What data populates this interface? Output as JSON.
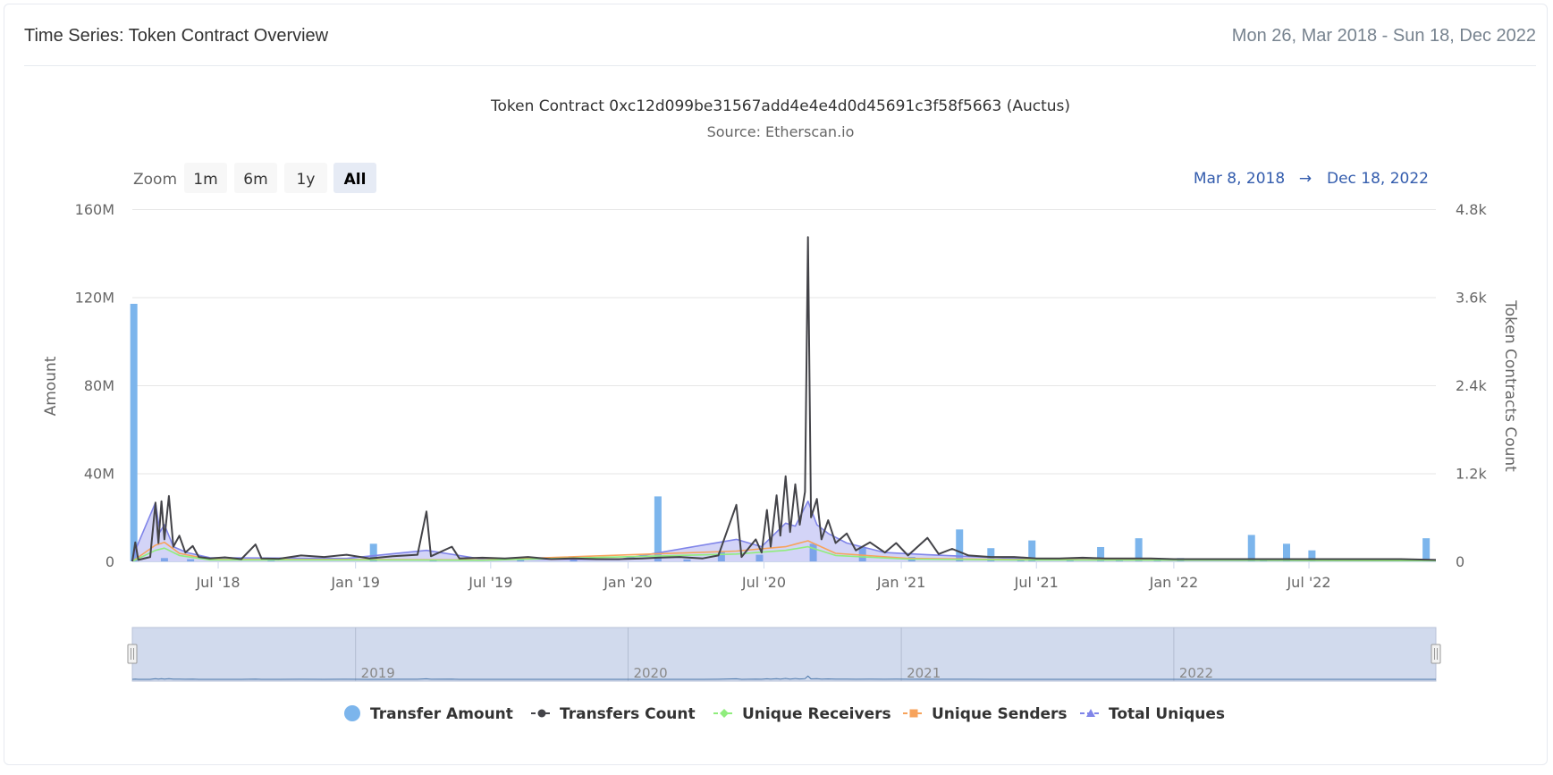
{
  "header": {
    "title": "Time Series: Token Contract Overview",
    "date_range": "Mon 26, Mar 2018 - Sun 18, Dec 2022"
  },
  "chart_data": {
    "type": "bar+line",
    "title": "Token Contract 0xc12d099be31567add4e4e4d0d45691c3f58f5663 (Auctus)",
    "subtitle": "Source: Etherscan.io",
    "zoom": {
      "label": "Zoom",
      "buttons": [
        "1m",
        "6m",
        "1y",
        "All"
      ],
      "selected": "All"
    },
    "range_selector": {
      "from": "Mar 8, 2018",
      "arrow": "→",
      "to": "Dec 18, 2022"
    },
    "x_ticks": [
      "Jul '18",
      "Jan '19",
      "Jul '19",
      "Jan '20",
      "Jul '20",
      "Jan '21",
      "Jul '21",
      "Jan '22",
      "Jul '22"
    ],
    "x_tick_dates": [
      "2018-07-01",
      "2019-01-01",
      "2019-07-01",
      "2020-01-01",
      "2020-07-01",
      "2021-01-01",
      "2021-07-01",
      "2022-01-01",
      "2022-07-01"
    ],
    "xlim": [
      "2018-03-08",
      "2022-12-18"
    ],
    "y_left": {
      "label": "Amount",
      "ticks": [
        "0",
        "40M",
        "80M",
        "120M",
        "160M"
      ],
      "range": [
        0,
        160000000
      ]
    },
    "y_right": {
      "label": "Token Contracts Count",
      "ticks": [
        "0",
        "1.2k",
        "2.4k",
        "3.6k",
        "4.8k"
      ],
      "range": [
        0,
        4800
      ]
    },
    "grid": true,
    "legend_position": "bottom",
    "series": [
      {
        "name": "Transfer Amount",
        "kind": "bar",
        "axis": "left",
        "color": "#7cb5ec",
        "points": [
          [
            "2018-03-10",
            117000000
          ],
          [
            "2018-04-20",
            1500000
          ],
          [
            "2018-05-25",
            1000000
          ],
          [
            "2018-09-10",
            600000
          ],
          [
            "2019-01-25",
            8000000
          ],
          [
            "2019-04-15",
            1000000
          ],
          [
            "2019-08-10",
            700000
          ],
          [
            "2019-10-20",
            1500000
          ],
          [
            "2020-02-10",
            29500000
          ],
          [
            "2020-03-20",
            900000
          ],
          [
            "2020-05-05",
            4500000
          ],
          [
            "2020-06-25",
            3000000
          ],
          [
            "2020-09-05",
            8000000
          ],
          [
            "2020-11-10",
            6500000
          ],
          [
            "2021-01-15",
            2000000
          ],
          [
            "2021-03-20",
            14500000
          ],
          [
            "2021-05-01",
            6000000
          ],
          [
            "2021-06-10",
            1000000
          ],
          [
            "2021-06-25",
            9500000
          ],
          [
            "2021-08-15",
            1000000
          ],
          [
            "2021-09-25",
            6500000
          ],
          [
            "2021-10-20",
            900000
          ],
          [
            "2021-11-15",
            10500000
          ],
          [
            "2021-12-10",
            1200000
          ],
          [
            "2022-01-10",
            1500000
          ],
          [
            "2022-04-15",
            12000000
          ],
          [
            "2022-05-01",
            1000000
          ],
          [
            "2022-06-01",
            8000000
          ],
          [
            "2022-07-05",
            5000000
          ],
          [
            "2022-11-10",
            800000
          ],
          [
            "2022-12-05",
            10500000
          ]
        ]
      },
      {
        "name": "Transfers Count",
        "kind": "line",
        "axis": "right",
        "color": "#434348",
        "points": [
          [
            "2018-03-08",
            0
          ],
          [
            "2018-03-12",
            260
          ],
          [
            "2018-03-16",
            20
          ],
          [
            "2018-04-01",
            60
          ],
          [
            "2018-04-08",
            800
          ],
          [
            "2018-04-12",
            250
          ],
          [
            "2018-04-16",
            820
          ],
          [
            "2018-04-20",
            300
          ],
          [
            "2018-04-26",
            890
          ],
          [
            "2018-05-02",
            200
          ],
          [
            "2018-05-10",
            350
          ],
          [
            "2018-05-18",
            120
          ],
          [
            "2018-05-28",
            210
          ],
          [
            "2018-06-05",
            60
          ],
          [
            "2018-06-20",
            40
          ],
          [
            "2018-07-10",
            55
          ],
          [
            "2018-08-01",
            30
          ],
          [
            "2018-08-20",
            230
          ],
          [
            "2018-08-28",
            40
          ],
          [
            "2018-09-20",
            35
          ],
          [
            "2018-10-20",
            80
          ],
          [
            "2018-11-20",
            60
          ],
          [
            "2018-12-20",
            90
          ],
          [
            "2019-01-20",
            40
          ],
          [
            "2019-02-20",
            70
          ],
          [
            "2019-03-25",
            90
          ],
          [
            "2019-04-06",
            680
          ],
          [
            "2019-04-12",
            70
          ],
          [
            "2019-05-10",
            200
          ],
          [
            "2019-05-20",
            40
          ],
          [
            "2019-06-20",
            50
          ],
          [
            "2019-07-20",
            40
          ],
          [
            "2019-08-20",
            60
          ],
          [
            "2019-09-20",
            30
          ],
          [
            "2019-10-20",
            40
          ],
          [
            "2019-11-20",
            30
          ],
          [
            "2019-12-20",
            30
          ],
          [
            "2020-01-20",
            40
          ],
          [
            "2020-02-10",
            50
          ],
          [
            "2020-03-10",
            60
          ],
          [
            "2020-04-10",
            40
          ],
          [
            "2020-05-01",
            80
          ],
          [
            "2020-05-25",
            770
          ],
          [
            "2020-06-01",
            60
          ],
          [
            "2020-06-20",
            300
          ],
          [
            "2020-06-28",
            120
          ],
          [
            "2020-07-05",
            700
          ],
          [
            "2020-07-10",
            200
          ],
          [
            "2020-07-18",
            900
          ],
          [
            "2020-07-23",
            350
          ],
          [
            "2020-07-30",
            1160
          ],
          [
            "2020-08-05",
            400
          ],
          [
            "2020-08-12",
            1050
          ],
          [
            "2020-08-18",
            500
          ],
          [
            "2020-08-25",
            950
          ],
          [
            "2020-08-29",
            4420
          ],
          [
            "2020-09-02",
            600
          ],
          [
            "2020-09-10",
            850
          ],
          [
            "2020-09-16",
            300
          ],
          [
            "2020-09-25",
            560
          ],
          [
            "2020-10-05",
            250
          ],
          [
            "2020-10-20",
            380
          ],
          [
            "2020-11-01",
            150
          ],
          [
            "2020-11-20",
            260
          ],
          [
            "2020-12-10",
            120
          ],
          [
            "2020-12-25",
            250
          ],
          [
            "2021-01-10",
            80
          ],
          [
            "2021-02-05",
            320
          ],
          [
            "2021-02-20",
            100
          ],
          [
            "2021-03-10",
            170
          ],
          [
            "2021-04-01",
            80
          ],
          [
            "2021-05-01",
            60
          ],
          [
            "2021-06-01",
            60
          ],
          [
            "2021-07-01",
            40
          ],
          [
            "2021-08-01",
            40
          ],
          [
            "2021-09-01",
            50
          ],
          [
            "2021-10-01",
            40
          ],
          [
            "2021-11-01",
            40
          ],
          [
            "2021-12-01",
            40
          ],
          [
            "2022-01-01",
            30
          ],
          [
            "2022-03-01",
            30
          ],
          [
            "2022-05-01",
            30
          ],
          [
            "2022-07-01",
            30
          ],
          [
            "2022-09-01",
            30
          ],
          [
            "2022-11-01",
            30
          ],
          [
            "2022-12-18",
            20
          ]
        ]
      },
      {
        "name": "Unique Receivers",
        "kind": "line",
        "axis": "right",
        "color": "#90ed7d",
        "points": [
          [
            "2018-03-08",
            0
          ],
          [
            "2018-04-08",
            150
          ],
          [
            "2018-04-20",
            180
          ],
          [
            "2018-05-10",
            80
          ],
          [
            "2018-06-20",
            20
          ],
          [
            "2018-12-20",
            20
          ],
          [
            "2019-06-20",
            15
          ],
          [
            "2020-05-25",
            100
          ],
          [
            "2020-07-30",
            150
          ],
          [
            "2020-08-29",
            200
          ],
          [
            "2020-10-05",
            80
          ],
          [
            "2021-01-10",
            30
          ],
          [
            "2021-06-01",
            20
          ],
          [
            "2022-12-18",
            10
          ]
        ]
      },
      {
        "name": "Unique Senders",
        "kind": "line",
        "axis": "right",
        "color": "#f7a35c",
        "points": [
          [
            "2018-03-08",
            0
          ],
          [
            "2018-04-08",
            220
          ],
          [
            "2018-04-20",
            260
          ],
          [
            "2018-05-10",
            110
          ],
          [
            "2018-06-20",
            25
          ],
          [
            "2018-12-20",
            25
          ],
          [
            "2019-06-20",
            20
          ],
          [
            "2020-05-25",
            140
          ],
          [
            "2020-07-30",
            200
          ],
          [
            "2020-08-29",
            280
          ],
          [
            "2020-10-05",
            110
          ],
          [
            "2021-01-10",
            40
          ],
          [
            "2021-06-01",
            25
          ],
          [
            "2022-12-18",
            10
          ]
        ]
      },
      {
        "name": "Total Uniques",
        "kind": "line",
        "axis": "right",
        "color": "#8085e9",
        "points": [
          [
            "2018-03-08",
            0
          ],
          [
            "2018-03-12",
            150
          ],
          [
            "2018-04-08",
            800
          ],
          [
            "2018-04-14",
            400
          ],
          [
            "2018-04-20",
            500
          ],
          [
            "2018-05-02",
            200
          ],
          [
            "2018-05-20",
            120
          ],
          [
            "2018-06-20",
            50
          ],
          [
            "2018-12-20",
            40
          ],
          [
            "2019-04-06",
            150
          ],
          [
            "2019-06-20",
            30
          ],
          [
            "2019-12-20",
            25
          ],
          [
            "2020-05-25",
            300
          ],
          [
            "2020-06-28",
            200
          ],
          [
            "2020-07-18",
            400
          ],
          [
            "2020-07-30",
            520
          ],
          [
            "2020-08-12",
            480
          ],
          [
            "2020-08-29",
            820
          ],
          [
            "2020-09-10",
            500
          ],
          [
            "2020-09-25",
            380
          ],
          [
            "2020-10-20",
            250
          ],
          [
            "2020-12-10",
            120
          ],
          [
            "2021-02-05",
            90
          ],
          [
            "2021-06-01",
            40
          ],
          [
            "2022-12-18",
            15
          ]
        ]
      }
    ],
    "navigator": {
      "labels": [
        "2019",
        "2020",
        "2021",
        "2022"
      ],
      "label_dates": [
        "2019-01-01",
        "2020-01-01",
        "2021-01-01",
        "2022-01-01"
      ]
    }
  },
  "colors": {
    "grid": "#e6e6e6",
    "axis_text": "#666666",
    "range_text": "#335cad",
    "navigator_fill": "#ccd6eb",
    "navigator_line": "#4572a7"
  },
  "icons": {
    "handle_left": "grip-handle-icon",
    "handle_right": "grip-handle-icon"
  }
}
